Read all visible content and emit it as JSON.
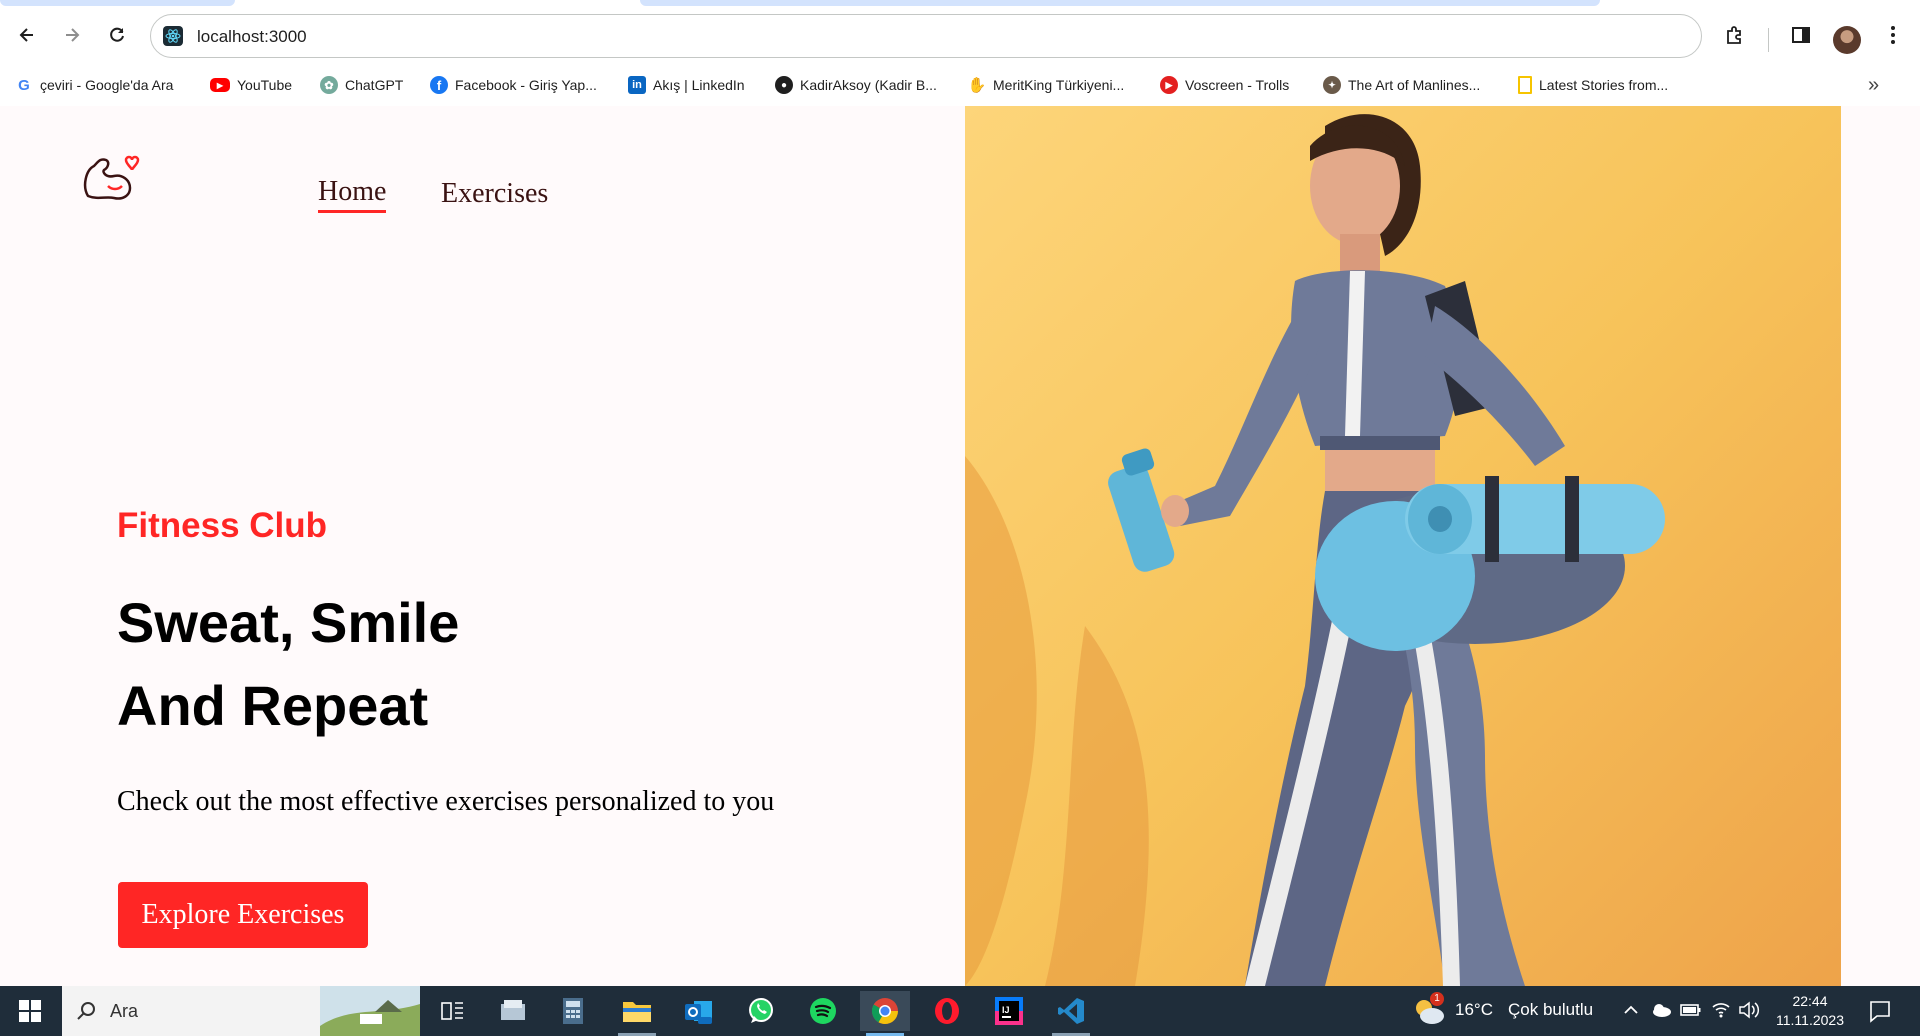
{
  "browser": {
    "url": "localhost:3000",
    "bookmarks": [
      {
        "label": "çeviri - Google'da Ara",
        "icon": "google-icon"
      },
      {
        "label": "YouTube",
        "icon": "youtube-icon"
      },
      {
        "label": "ChatGPT",
        "icon": "chatgpt-icon"
      },
      {
        "label": "Facebook - Giriş Yap...",
        "icon": "facebook-icon"
      },
      {
        "label": "Akış | LinkedIn",
        "icon": "linkedin-icon"
      },
      {
        "label": "KadirAksoy (Kadir B...",
        "icon": "github-icon"
      },
      {
        "label": "MeritKing Türkiyeni...",
        "icon": "hand-icon"
      },
      {
        "label": "Voscreen - Trolls",
        "icon": "voscreen-icon"
      },
      {
        "label": "The Art of Manlines...",
        "icon": "manliness-icon"
      },
      {
        "label": "Latest Stories from...",
        "icon": "bookmark-yellow-icon"
      }
    ]
  },
  "page": {
    "nav": {
      "home": "Home",
      "exercises": "Exercises"
    },
    "hero": {
      "subtitle": "Fitness Club",
      "title_line1": "Sweat, Smile",
      "title_line2": "And Repeat",
      "description": "Check out the most effective exercises personalized to you",
      "button": "Explore Exercises"
    },
    "colors": {
      "accent": "#ff2625",
      "background": "#fffafb",
      "image_bg": "#f7c35a"
    }
  },
  "taskbar": {
    "search_placeholder": "Ara",
    "weather_temp": "16°C",
    "weather_desc": "Çok bulutlu",
    "weather_badge": "1",
    "time": "22:44",
    "date": "11.11.2023",
    "apps": [
      "task-view",
      "file-explorer-old",
      "calculator",
      "file-explorer",
      "outlook",
      "whatsapp",
      "spotify",
      "chrome",
      "opera",
      "intellij",
      "vscode"
    ]
  }
}
